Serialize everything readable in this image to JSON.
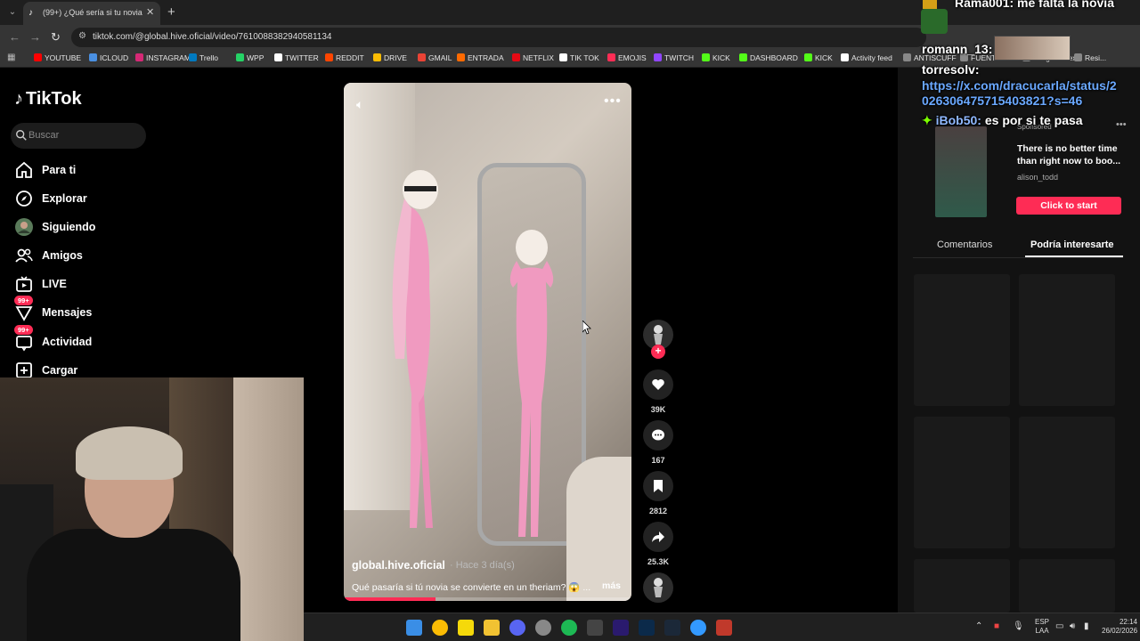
{
  "browser": {
    "tab_title": "(99+) ¿Qué sería si tu novia",
    "url": "tiktok.com/@global.hive.oficial/video/7610088382940581134",
    "bookmarks": [
      {
        "label": "YOUTUBE",
        "color": "#ff0000"
      },
      {
        "label": "ICLOUD",
        "color": "#4a90e2"
      },
      {
        "label": "INSTAGRAM",
        "color": "#d62976"
      },
      {
        "label": "Trello",
        "color": "#0079bf"
      },
      {
        "label": "WPP",
        "color": "#25d366"
      },
      {
        "label": "TWITTER",
        "color": "#ffffff"
      },
      {
        "label": "REDDIT",
        "color": "#ff4500"
      },
      {
        "label": "DRIVE",
        "color": "#fbbc04"
      },
      {
        "label": "GMAIL",
        "color": "#ea4335"
      },
      {
        "label": "ENTRADA",
        "color": "#ff6a00"
      },
      {
        "label": "NETFLIX",
        "color": "#e50914"
      },
      {
        "label": "TIK TOK",
        "color": "#ffffff"
      },
      {
        "label": "EMOJIS",
        "color": "#ff2d55"
      },
      {
        "label": "TWITCH",
        "color": "#9146ff"
      },
      {
        "label": "KICK",
        "color": "#53fc18"
      },
      {
        "label": "DASHBOARD",
        "color": "#53fc18"
      },
      {
        "label": "KICK",
        "color": "#53fc18"
      },
      {
        "label": "Activity feed",
        "color": "#ffffff"
      },
      {
        "label": "ANTISCUFF",
        "color": "#888888"
      },
      {
        "label": "FUENTES",
        "color": "#888888"
      },
      {
        "label": "Image to Text",
        "color": "#888888"
      },
      {
        "label": "Resi...",
        "color": "#888888"
      }
    ]
  },
  "tiktok": {
    "logo": "TikTok",
    "search_placeholder": "Buscar",
    "nav": [
      {
        "label": "Para ti",
        "icon": "home-icon",
        "badge": ""
      },
      {
        "label": "Explorar",
        "icon": "compass-icon",
        "badge": ""
      },
      {
        "label": "Siguiendo",
        "icon": "following-avatar-icon",
        "badge": ""
      },
      {
        "label": "Amigos",
        "icon": "friends-icon",
        "badge": ""
      },
      {
        "label": "LIVE",
        "icon": "live-icon",
        "badge": ""
      },
      {
        "label": "Mensajes",
        "icon": "messages-icon",
        "badge": "99+"
      },
      {
        "label": "Actividad",
        "icon": "activity-icon",
        "badge": "99+"
      },
      {
        "label": "Cargar",
        "icon": "upload-icon",
        "badge": ""
      }
    ],
    "video": {
      "author": "global.hive.oficial",
      "time": "· Hace 3 día(s)",
      "caption": "Qué pasaría si tú novia se convierte en un theriam? 😱 ...",
      "more": "más",
      "progress": 0.32
    },
    "actions": {
      "likes": "39K",
      "comments": "167",
      "saves": "2812",
      "shares": "25.3K"
    },
    "ad": {
      "sponsored": "Sponsored",
      "text": "There is no better time than right now to boo...",
      "handle": "alison_todd",
      "button": "Click to start"
    },
    "tabs": {
      "comments": "Comentarios",
      "interest": "Podría interesarte"
    }
  },
  "chat": [
    {
      "user": "Rama001:",
      "msg": "me falta la novia"
    },
    {
      "user": "romann_13:",
      "msg": ""
    },
    {
      "user": "torresolv:",
      "msg": ""
    },
    {
      "user": "",
      "msg": "https://x.com/dracucarla/status/2"
    },
    {
      "user": "",
      "msg": "026306475715403821?s=46"
    },
    {
      "user": "iBob50:",
      "msg": "es por si te pasa"
    }
  ],
  "taskbar": {
    "lang_top": "ESP",
    "lang_bottom": "LAA",
    "time": "22:14",
    "date": "26/02/2026"
  }
}
